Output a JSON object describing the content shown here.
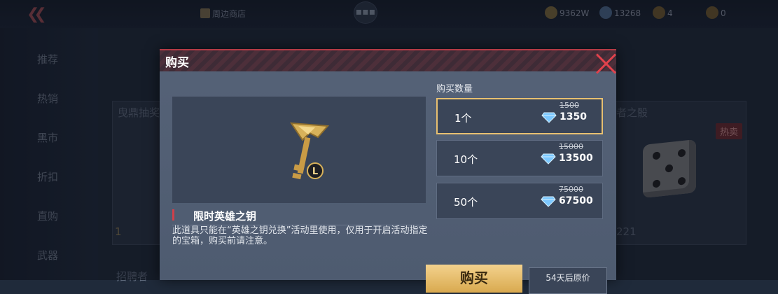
{
  "topbar": {
    "back_icon": "double-chevron-left-icon",
    "shop_link": "周边商店",
    "currencies": [
      {
        "icon": "gold-coin-icon",
        "value": "9362W"
      },
      {
        "icon": "bullet-icon",
        "value": "13268"
      },
      {
        "icon": "medal-icon",
        "value": "4"
      },
      {
        "icon": "coin-icon",
        "value": "0"
      }
    ]
  },
  "sidebar": {
    "items": [
      {
        "label": "推荐"
      },
      {
        "label": "热销"
      },
      {
        "label": "黑市"
      },
      {
        "label": "折扣"
      },
      {
        "label": "直购"
      },
      {
        "label": "武器"
      }
    ]
  },
  "background": {
    "card_left_title": "曳鼎抽奖",
    "card_left_count": "1",
    "card_right_title": "者之骰",
    "card_right_tag": "热卖",
    "card_right_count": "221",
    "bottom_left_title": "招聘者"
  },
  "dialog": {
    "title": "购买",
    "item_name": "限时英雄之钥",
    "item_desc": "此道具只能在“英雄之钥兑换”活动里使用，仅用于开启活动指定的宝箱，购买前请注意。",
    "quantity_label": "购买数量",
    "options": [
      {
        "qty": "1个",
        "old_price": "1500",
        "price": "1350",
        "selected": true
      },
      {
        "qty": "10个",
        "old_price": "15000",
        "price": "13500",
        "selected": false
      },
      {
        "qty": "50个",
        "old_price": "75000",
        "price": "67500",
        "selected": false
      }
    ],
    "buy_button": "购买",
    "restore_button": "54天后原价"
  },
  "colors": {
    "accent_red": "#e0424c",
    "selected_border": "#e8c070",
    "buy_button": "#e8c070",
    "diamond": "#7cc8ff"
  }
}
